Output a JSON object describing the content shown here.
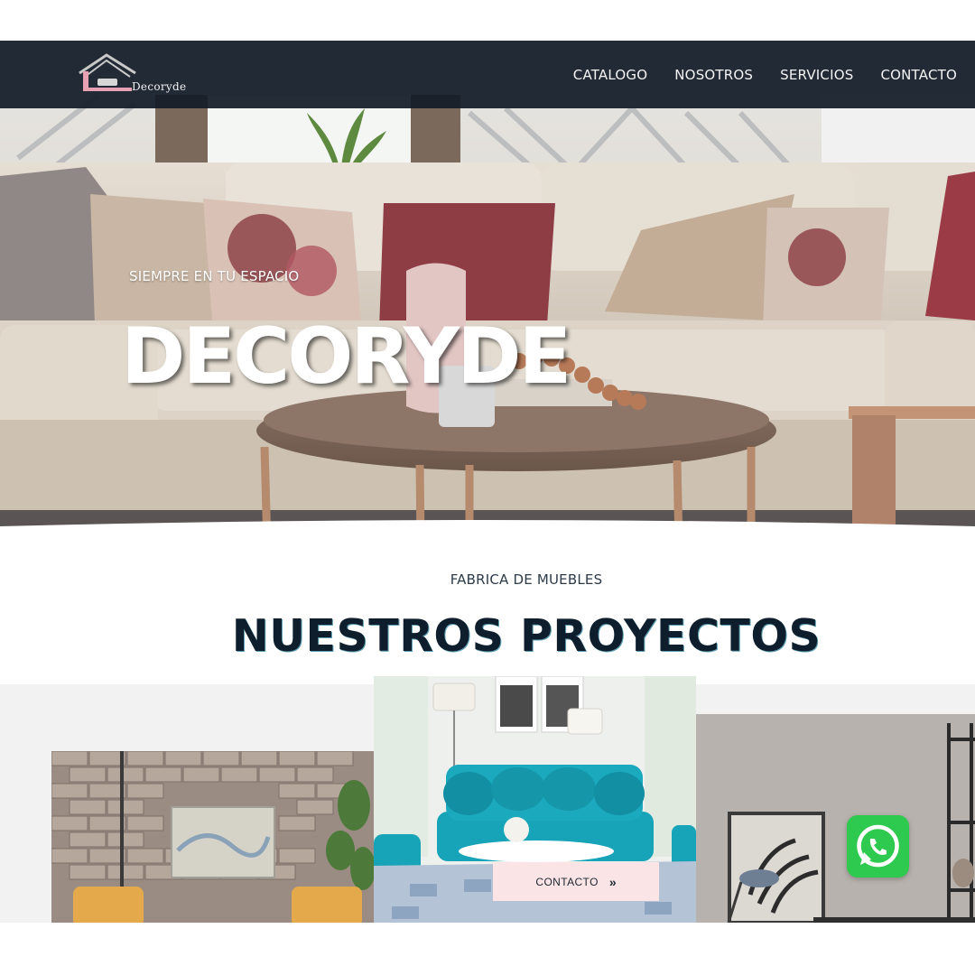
{
  "brand": {
    "name": "Decoryde",
    "colors": {
      "nav": "#121c28",
      "accent_pink": "#e7a1b3",
      "button_bg": "#fbe4e6",
      "whatsapp": "#2ec94f"
    }
  },
  "nav": {
    "items": [
      {
        "label": "CATALOGO"
      },
      {
        "label": "NOSOTROS"
      },
      {
        "label": "SERVICIOS"
      },
      {
        "label": "CONTACTO"
      }
    ]
  },
  "hero": {
    "kicker": "SIEMPRE EN TU ESPACIO",
    "title": "DECORYDE"
  },
  "section": {
    "kicker": "FABRICA DE MUEBLES",
    "title": "NUESTROS PROYECTOS"
  },
  "cta": {
    "label": "CONTACTO",
    "icon": "double-chevron-right-icon"
  },
  "floating": {
    "icon": "whatsapp-icon"
  }
}
